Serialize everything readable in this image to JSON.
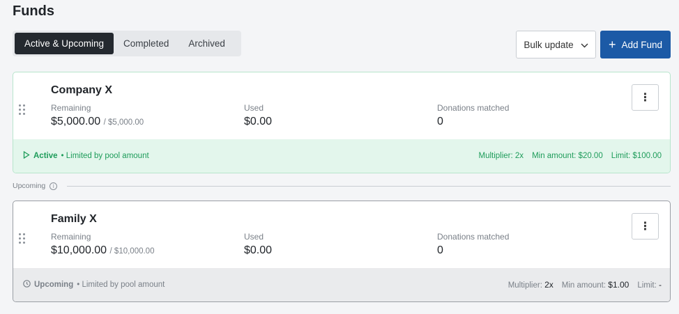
{
  "page": {
    "title": "Funds"
  },
  "tabs": [
    {
      "label": "Active & Upcoming",
      "active": true
    },
    {
      "label": "Completed",
      "active": false
    },
    {
      "label": "Archived",
      "active": false
    }
  ],
  "toolbar": {
    "bulk_update_label": "Bulk update",
    "add_fund_label": "Add Fund"
  },
  "section": {
    "upcoming_label": "Upcoming"
  },
  "funds": [
    {
      "name": "Company X",
      "remaining_label": "Remaining",
      "remaining": "$5,000.00",
      "remaining_total": "/ $5,000.00",
      "used_label": "Used",
      "used": "$0.00",
      "donations_label": "Donations matched",
      "donations": "0",
      "status": "Active",
      "status_note": "• Limited by pool amount",
      "multiplier_label": "Multiplier:",
      "multiplier": "2x",
      "min_amount_label": "Min amount:",
      "min_amount": "$20.00",
      "limit_label": "Limit:",
      "limit": "$100.00"
    },
    {
      "name": "Family X",
      "remaining_label": "Remaining",
      "remaining": "$10,000.00",
      "remaining_total": "/ $10,000.00",
      "used_label": "Used",
      "used": "$0.00",
      "donations_label": "Donations matched",
      "donations": "0",
      "status": "Upcoming",
      "status_note": "• Limited by pool amount",
      "multiplier_label": "Multiplier:",
      "multiplier": "2x",
      "min_amount_label": "Min amount:",
      "min_amount": "$1.00",
      "limit_label": "Limit:",
      "limit": "-"
    }
  ],
  "colors": {
    "primary": "#1c5aa6",
    "active_green": "#1e9c5a",
    "active_bg": "#e3f6ec",
    "tab_active_bg": "#24292f"
  },
  "icons": {
    "drag": "drag-handle-icon",
    "kebab": "more-vertical-icon",
    "chevron": "chevron-down-icon",
    "plus": "plus-icon",
    "play": "play-icon",
    "clock": "clock-icon",
    "info": "info-icon"
  }
}
